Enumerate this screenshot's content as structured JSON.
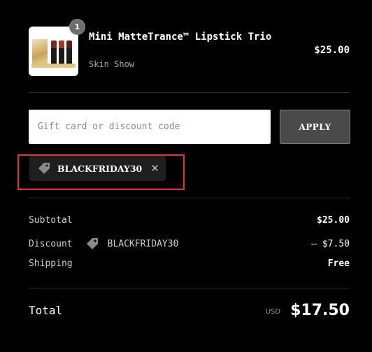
{
  "item": {
    "title": "Mini MatteTrance™ Lipstick Trio",
    "variant": "Skin Show",
    "price": "$25.00",
    "quantity": "1"
  },
  "discount": {
    "placeholder": "Gift card or discount code",
    "apply_label": "APPLY",
    "applied_code": "BLACKFRIDAY30"
  },
  "summary": {
    "subtotal_label": "Subtotal",
    "subtotal_value": "$25.00",
    "discount_label": "Discount",
    "discount_code": "BLACKFRIDAY30",
    "discount_value": "– $7.50",
    "shipping_label": "Shipping",
    "shipping_value": "Free",
    "total_label": "Total",
    "currency": "USD",
    "total_value": "$17.50"
  },
  "colors": {
    "background": "#000000",
    "highlight": "#e2313f",
    "apply_button": "#4a4a4a"
  },
  "icons": {
    "tag": "tag-icon",
    "remove": "close-icon"
  }
}
